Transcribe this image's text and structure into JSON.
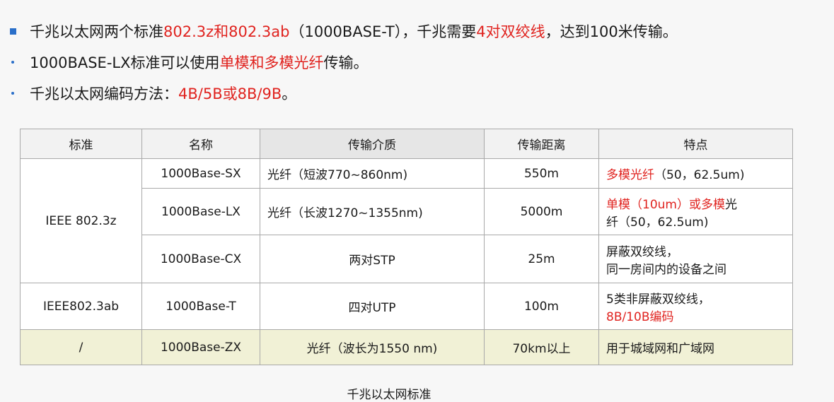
{
  "bullets": [
    {
      "icon": "square-bullet",
      "parts": [
        {
          "text": "千兆以太网两个标准",
          "color": "#1a1a1a"
        },
        {
          "text": "802.3z和802.3ab",
          "color": "#e0231f"
        },
        {
          "text": "（1000BASE-T），千兆需要",
          "color": "#1a1a1a"
        },
        {
          "text": "4对双绞线",
          "color": "#e0231f"
        },
        {
          "text": "，达到100米传输。",
          "color": "#1a1a1a"
        }
      ]
    },
    {
      "icon": "dot-bullet",
      "parts": [
        {
          "text": "1000BASE-LX标准可以使用",
          "color": "#1a1a1a"
        },
        {
          "text": "单模和多模光纤",
          "color": "#e0231f"
        },
        {
          "text": "传输。",
          "color": "#1a1a1a"
        }
      ]
    },
    {
      "icon": "dot-bullet",
      "parts": [
        {
          "text": "千兆以太网编码方法：",
          "color": "#1a1a1a"
        },
        {
          "text": "4B/5B或8B/9B",
          "color": "#e0231f"
        },
        {
          "text": "。",
          "color": "#1a1a1a"
        }
      ]
    }
  ],
  "table": {
    "headers": [
      "标准",
      "名称",
      "传输介质",
      "传输距离",
      "特点"
    ],
    "group_802_3z": "IEEE 802.3z",
    "rows": [
      {
        "name": "1000Base-SX",
        "medium": "光纤（短波770~860nm)",
        "distance": "550m",
        "feature_red": "多模光纤",
        "feature_black": "（50，62.5um)"
      },
      {
        "name": "1000Base-LX",
        "medium": "光纤（长波1270~1355nm)",
        "distance": "5000m",
        "feature_red": "单模（10um）或多模",
        "feature_black_1": "光",
        "feature_black_2": "纤（50，62.5um)"
      },
      {
        "name": "1000Base-CX",
        "medium": "两对STP",
        "distance": "25m",
        "feature_line1": "屏蔽双绞线，",
        "feature_line2": "同一房间内的设备之间"
      },
      {
        "standard": "IEEE802.3ab",
        "name": "1000Base-T",
        "medium": "四对UTP",
        "distance": "100m",
        "feature_line1": "5类非屏蔽双绞线，",
        "feature_line2_red": "8B/10B编码"
      },
      {
        "standard": "/",
        "name": "1000Base-ZX",
        "medium": "光纤（波长为1550 nm)",
        "distance": "70km以上",
        "feature": "用于城域网和广域网"
      }
    ]
  },
  "caption": "千兆以太网标准",
  "colors": {
    "accent_red": "#e0231f",
    "bullet_blue": "#2a6fc9",
    "highlight_row": "#f1f1d6"
  }
}
